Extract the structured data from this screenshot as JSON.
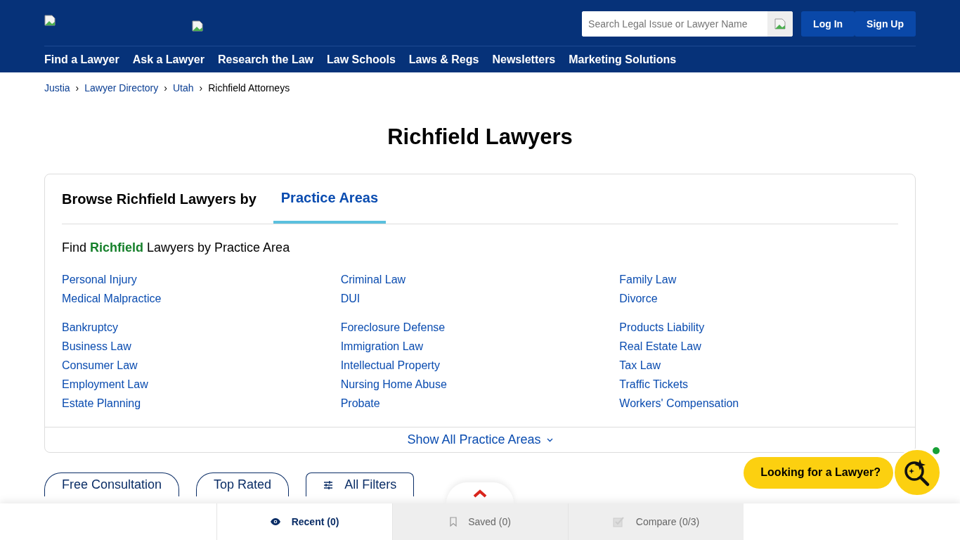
{
  "header": {
    "search": {
      "placeholder": "Search Legal Issue or Lawyer Name"
    },
    "buttons": [
      "Log In",
      "Sign Up"
    ]
  },
  "nav": [
    "Find a Lawyer",
    "Ask a Lawyer",
    "Research the Law",
    "Law Schools",
    "Laws & Regs",
    "Newsletters",
    "Marketing Solutions"
  ],
  "breadcrumb": [
    "Justia",
    "Lawyer Directory",
    "Utah",
    "Richfield Attorneys"
  ],
  "breadcrumb_separator": "›",
  "title": "Richfield Lawyers",
  "browse": {
    "label": "Browse Richfield Lawyers by",
    "tabs": [
      {
        "label": "Practice Areas",
        "selected": true
      }
    ],
    "heading": "Find **Richfield** Lawyers by Practice Area",
    "groups": [
      [
        [
          "Personal Injury",
          "Medical Malpractice"
        ],
        [
          "Criminal Law",
          "DUI"
        ],
        [
          "Family Law",
          "Divorce"
        ]
      ],
      [
        [
          "Bankruptcy",
          "Business Law",
          "Consumer Law",
          "Employment Law",
          "Estate Planning"
        ],
        [
          "Foreclosure Defense",
          "Immigration Law",
          "Intellectual Property",
          "Nursing Home Abuse",
          "Probate"
        ],
        [
          "Products Liability",
          "Real Estate Law",
          "Tax Law",
          "Traffic Tickets",
          "Workers' Compensation"
        ]
      ]
    ],
    "show_all": "Show All Practice Areas"
  },
  "filters": [
    {
      "label": "Free Consultation",
      "kind": "pill"
    },
    {
      "label": "Top Rated",
      "kind": "pill"
    },
    {
      "label": "All Filters",
      "kind": "menu"
    }
  ],
  "assistant": {
    "label": "Looking for a Lawyer?",
    "online": true
  },
  "bottom_tabs": [
    {
      "label": "Recent (0)",
      "kind": "recent",
      "selected": true
    },
    {
      "label": "Saved (0)",
      "kind": "saved",
      "selected": false
    },
    {
      "label": "Compare (0/3)",
      "kind": "compare",
      "selected": false
    }
  ]
}
